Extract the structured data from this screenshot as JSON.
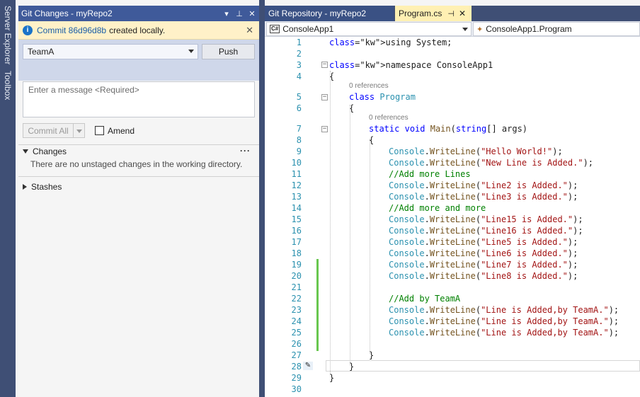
{
  "sidebar_tabs": [
    "Server Explorer",
    "Toolbox"
  ],
  "git_panel": {
    "title": "Git Changes - myRepo2",
    "info": {
      "commit_link": "Commit 86d96d8b",
      "text": "created locally."
    },
    "branch": "TeamA",
    "push_label": "Push",
    "message_placeholder": "Enter a message <Required>",
    "commit_all_label": "Commit All",
    "amend_label": "Amend",
    "changes_header": "Changes",
    "changes_note": "There are no unstaged changes in the working directory.",
    "stashes_header": "Stashes"
  },
  "editor_tabs": [
    {
      "label": "Git Repository - myRepo2",
      "active": false
    },
    {
      "label": "Program.cs",
      "active": true
    }
  ],
  "navbar": {
    "project": "ConsoleApp1",
    "class": "ConsoleApp1.Program"
  },
  "code": {
    "references_label": "0 references",
    "lines": [
      "using System;",
      "",
      "namespace ConsoleApp1",
      "{",
      "class Program",
      "{",
      "static void Main(string[] args)",
      "{",
      "Console.WriteLine(\"Hello World!\");",
      "Console.WriteLine(\"New Line is Added.\");",
      "//Add more Lines",
      "Console.WriteLine(\"Line2 is Added.\");",
      "Console.WriteLine(\"Line3 is Added.\");",
      "//Add more and more",
      "Console.WriteLine(\"Line15 is Added.\");",
      "Console.WriteLine(\"Line16 is Added.\");",
      "Console.WriteLine(\"Line5 is Added.\");",
      "Console.WriteLine(\"Line6 is Added.\");",
      "Console.WriteLine(\"Line7 is Added.\");",
      "Console.WriteLine(\"Line8 is Added.\");",
      "",
      "//Add by TeamA",
      "Console.WriteLine(\"Line is Added,by TeamA.\");",
      "Console.WriteLine(\"Line is Added,by TeamA.\");",
      "Console.WriteLine(\"Line is Added,by TeamA.\");",
      "",
      "}",
      "}",
      "}",
      ""
    ]
  },
  "colors": {
    "title_bar": "#3f5a9a",
    "active_tab": "#fff0b3",
    "change_marker": "#68c74f",
    "keyword": "#0000ff",
    "type": "#2b91af",
    "string": "#a31515",
    "comment": "#008000"
  }
}
